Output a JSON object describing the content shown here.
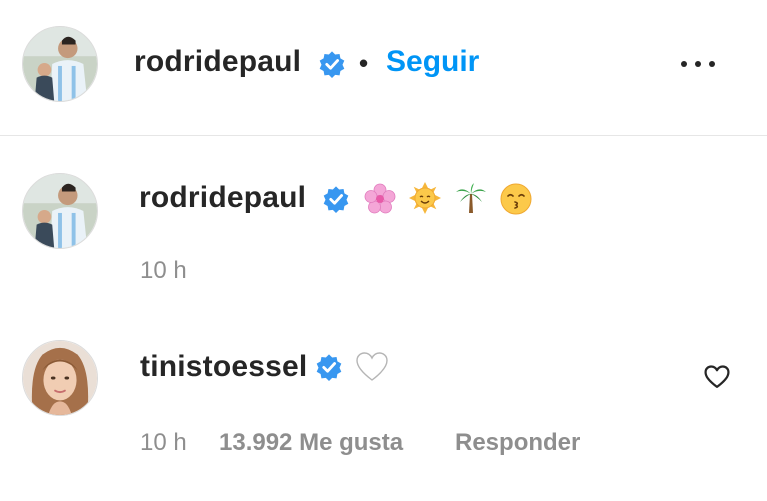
{
  "post_header": {
    "username": "rodridepaul",
    "separator": "•",
    "follow_label": "Seguir"
  },
  "caption": {
    "username": "rodridepaul",
    "emojis": [
      "cherry-blossom",
      "smiling-sun",
      "palm-tree",
      "kissing-face"
    ],
    "time": "10 h"
  },
  "comment": {
    "username": "tinistoessel",
    "text_emoji": "white-heart",
    "time": "10 h",
    "likes": "13.992 Me gusta",
    "reply_label": "Responder"
  },
  "colors": {
    "link_blue": "#0095f6",
    "verified_blue": "#3897f0",
    "secondary_text": "#8e8e8e",
    "primary_text": "#262626"
  }
}
